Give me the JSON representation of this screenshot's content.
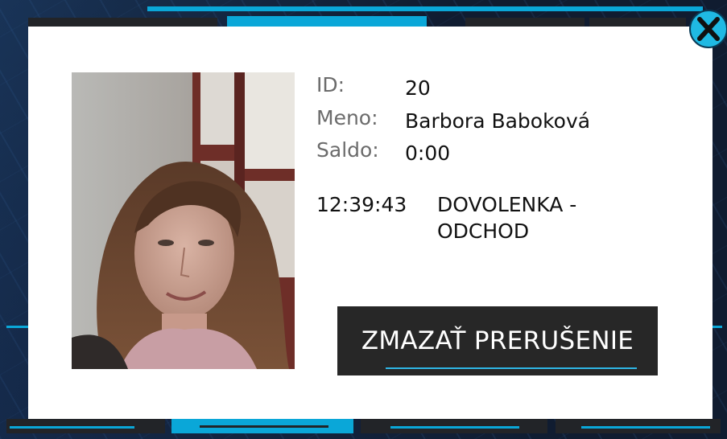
{
  "person": {
    "id_label": "ID:",
    "id_value": "20",
    "name_label": "Meno:",
    "name_value": "Barbora Baboková",
    "balance_label": "Saldo:",
    "balance_value": "0:00"
  },
  "event": {
    "time": "12:39:43",
    "description": "DOVOLENKA - ODCHOD"
  },
  "actions": {
    "clear_label": "ZMAZAŤ PRERUŠENIE"
  },
  "icons": {
    "close": "close-icon",
    "photo": "profile-photo"
  },
  "colors": {
    "accent": "#1fb9e3",
    "button_bg": "#272727",
    "modal_bg": "#ffffff"
  }
}
